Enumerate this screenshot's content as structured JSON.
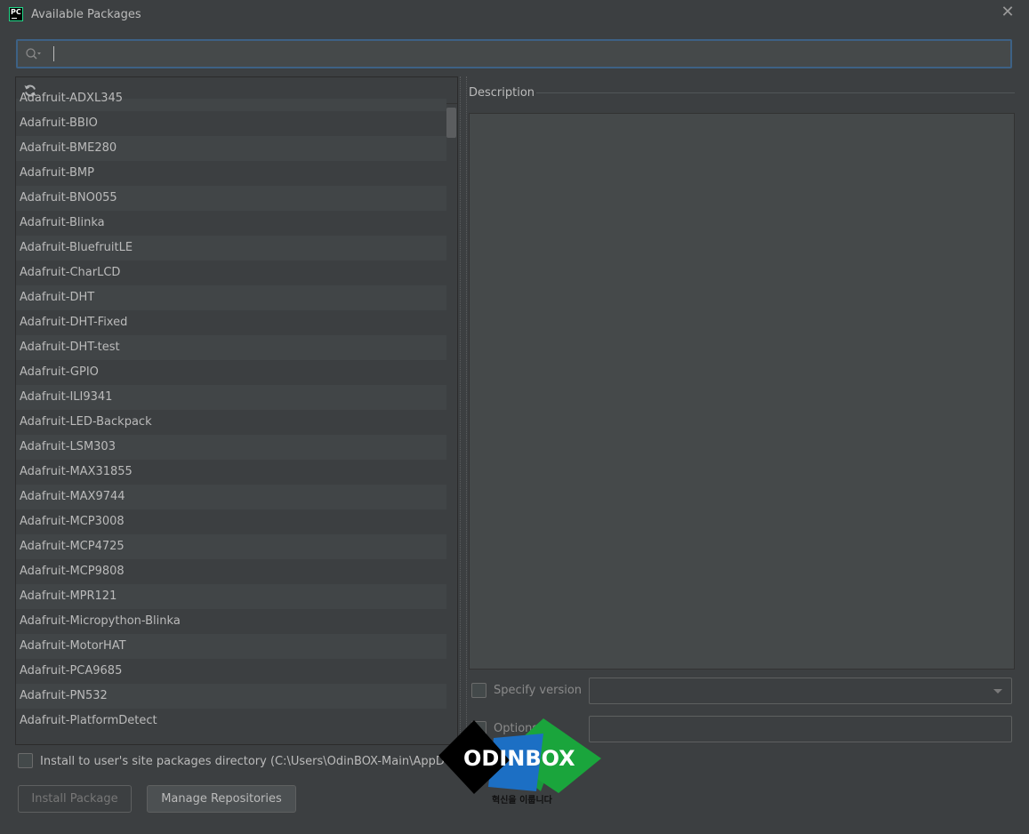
{
  "window": {
    "title": "Available Packages",
    "app_icon_text": "PC"
  },
  "search": {
    "value": "",
    "placeholder": ""
  },
  "packages": [
    "Adafruit-ADXL345",
    "Adafruit-BBIO",
    "Adafruit-BME280",
    "Adafruit-BMP",
    "Adafruit-BNO055",
    "Adafruit-Blinka",
    "Adafruit-BluefruitLE",
    "Adafruit-CharLCD",
    "Adafruit-DHT",
    "Adafruit-DHT-Fixed",
    "Adafruit-DHT-test",
    "Adafruit-GPIO",
    "Adafruit-ILI9341",
    "Adafruit-LED-Backpack",
    "Adafruit-LSM303",
    "Adafruit-MAX31855",
    "Adafruit-MAX9744",
    "Adafruit-MCP3008",
    "Adafruit-MCP4725",
    "Adafruit-MCP9808",
    "Adafruit-MPR121",
    "Adafruit-Micropython-Blinka",
    "Adafruit-MotorHAT",
    "Adafruit-PCA9685",
    "Adafruit-PN532",
    "Adafruit-PlatformDetect"
  ],
  "description": {
    "label": "Description",
    "text": ""
  },
  "specify_version": {
    "label": "Specify version",
    "checked": false,
    "selected": ""
  },
  "options": {
    "label": "Options",
    "checked": false,
    "value": ""
  },
  "install_user": {
    "label": "Install to user's site packages directory (C:\\Users\\OdinBOX-Main\\AppD",
    "checked": false
  },
  "buttons": {
    "install": "Install Package",
    "manage": "Manage Repositories"
  },
  "watermark": {
    "brand": "ODINBOX",
    "tagline": "혁신을 이룹니다"
  },
  "colors": {
    "background": "#3c3f41",
    "focus_border": "#3d6185",
    "text": "#bbbbbb",
    "disabled_text": "#777777"
  }
}
